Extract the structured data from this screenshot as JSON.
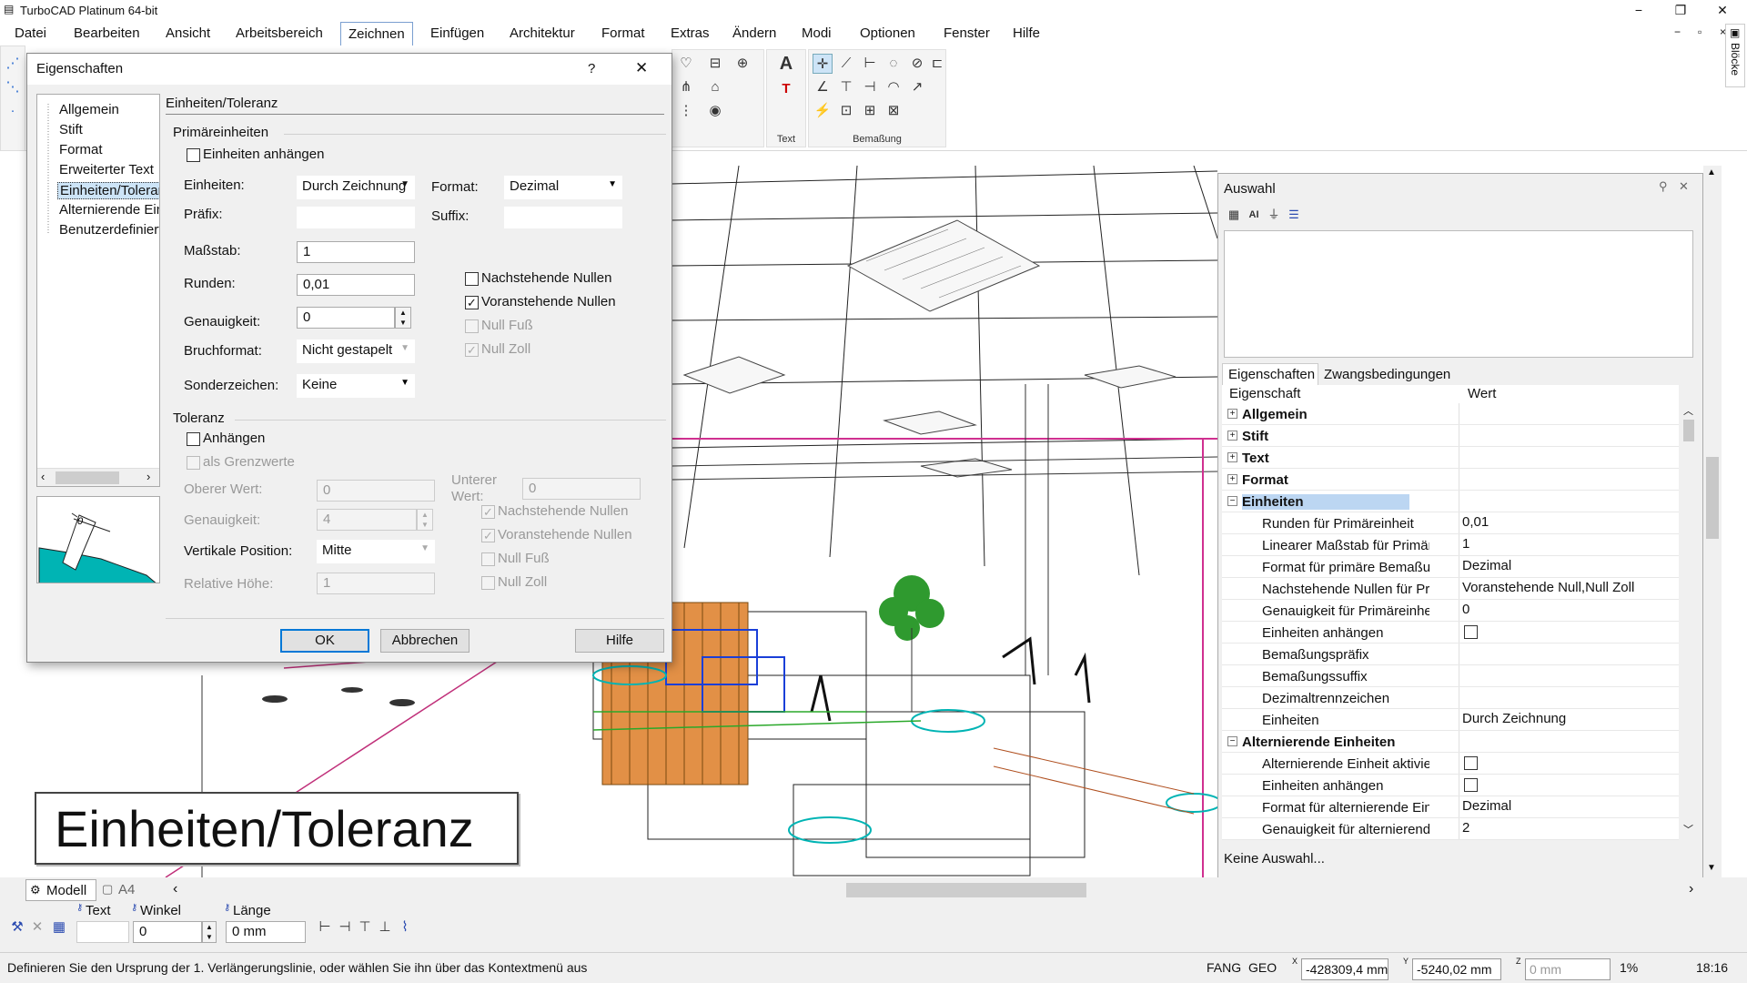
{
  "app": {
    "title": "TurboCAD  Platinum 64-bit",
    "window_controls": [
      "−",
      "❐",
      "✕"
    ],
    "mdi_controls": [
      "−",
      "▫",
      "×"
    ],
    "side_tab": "Blöcke"
  },
  "menu": {
    "items": [
      "Datei",
      "Bearbeiten",
      "Ansicht",
      "Arbeitsbereich",
      "Zeichnen",
      "Einfügen",
      "Architektur",
      "Format",
      "Extras",
      "Ändern",
      "Modi",
      "Optionen",
      "Fenster",
      "Hilfe"
    ],
    "active_index": 4
  },
  "ribbon": {
    "group_text_label": "Text",
    "group_dim_label": "Bemaßung"
  },
  "dialog": {
    "title": "Eigenschaften",
    "help_glyph": "?",
    "close_glyph": "✕",
    "tree": [
      "Allgemein",
      "Stift",
      "Format",
      "Erweiterter Text",
      "Einheiten/Toleranz",
      "Alternierende Einheiten",
      "Benutzerdefiniert"
    ],
    "tree_selected_index": 4,
    "section_title": "Einheiten/Toleranz",
    "primary": {
      "heading": "Primäreinheiten",
      "attach_units": {
        "label": "Einheiten anhängen",
        "checked": false
      },
      "units": {
        "label": "Einheiten:",
        "value": "Durch Zeichnung"
      },
      "format": {
        "label": "Format:",
        "value": "Dezimal"
      },
      "prefix": {
        "label": "Präfix:",
        "value": ""
      },
      "suffix": {
        "label": "Suffix:",
        "value": ""
      },
      "scale": {
        "label": "Maßstab:",
        "value": "1"
      },
      "round": {
        "label": "Runden:",
        "value": "0,01"
      },
      "precision": {
        "label": "Genauigkeit:",
        "value": "0"
      },
      "fraction": {
        "label": "Bruchformat:",
        "value": "Nicht gestapelt"
      },
      "special": {
        "label": "Sonderzeichen:",
        "value": "Keine"
      },
      "trailing_zeros": {
        "label": "Nachstehende Nullen",
        "checked": false
      },
      "leading_zeros": {
        "label": "Voranstehende Nullen",
        "checked": true
      },
      "zero_feet": {
        "label": "Null Fuß",
        "checked": false
      },
      "zero_inches": {
        "label": "Null Zoll",
        "checked": true
      }
    },
    "tolerance": {
      "heading": "Toleranz",
      "attach": {
        "label": "Anhängen",
        "checked": false
      },
      "as_limits": {
        "label": "als Grenzwerte",
        "checked": false
      },
      "upper": {
        "label": "Oberer Wert:",
        "value": "0"
      },
      "lower": {
        "label": "Unterer Wert:",
        "value": "0"
      },
      "precision": {
        "label": "Genauigkeit:",
        "value": "4"
      },
      "vertical_position": {
        "label": "Vertikale Position:",
        "value": "Mitte"
      },
      "relative_height": {
        "label": "Relative Höhe:",
        "value": "1"
      },
      "trailing_zeros": {
        "label": "Nachstehende Nullen",
        "checked": true
      },
      "leading_zeros": {
        "label": "Voranstehende Nullen",
        "checked": true
      },
      "zero_feet": {
        "label": "Null Fuß",
        "checked": false
      },
      "zero_inches": {
        "label": "Null Zoll",
        "checked": false
      }
    },
    "preview_text": "0",
    "buttons": {
      "ok": "OK",
      "cancel": "Abbrechen",
      "help": "Hilfe"
    }
  },
  "auswahl": {
    "title": "Auswahl",
    "toolbar_icons": [
      "properties-icon",
      "all-text-icon",
      "filter-icon",
      "layers-icon"
    ],
    "tabs": [
      "Eigenschaften",
      "Zwangsbedingungen"
    ],
    "col_property": "Eigenschaft",
    "col_value": "Wert",
    "rows": [
      {
        "k": "Allgemein",
        "v": "",
        "cat": true,
        "exp": "+"
      },
      {
        "k": "Stift",
        "v": "",
        "cat": true,
        "exp": "+"
      },
      {
        "k": "Text",
        "v": "",
        "cat": true,
        "exp": "+"
      },
      {
        "k": "Format",
        "v": "",
        "cat": true,
        "exp": "+"
      },
      {
        "k": "Einheiten",
        "v": "",
        "cat": true,
        "exp": "−",
        "sel": true
      },
      {
        "k": "Runden für Primäreinheit",
        "v": "0,01"
      },
      {
        "k": "Linearer Maßstab für Primärei...",
        "v": "1"
      },
      {
        "k": "Format für primäre Bemaßung...",
        "v": "Dezimal"
      },
      {
        "k": "Nachstehende Nullen für Prim...",
        "v": "Voranstehende Null,Null Zoll"
      },
      {
        "k": "Genauigkeit für Primäreinheit",
        "v": "0"
      },
      {
        "k": "Einheiten anhängen",
        "v": "",
        "checkbox": true
      },
      {
        "k": "Bemaßungspräfix",
        "v": ""
      },
      {
        "k": "Bemaßungssuffix",
        "v": ""
      },
      {
        "k": "Dezimaltrennzeichen",
        "v": ""
      },
      {
        "k": "Einheiten",
        "v": "Durch Zeichnung"
      },
      {
        "k": "Alternierende Einheiten",
        "v": "",
        "cat": true,
        "exp": "−"
      },
      {
        "k": "Alternierende Einheit aktiviert",
        "v": "",
        "checkbox": true
      },
      {
        "k": "Einheiten anhängen",
        "v": "",
        "checkbox": true
      },
      {
        "k": "Format für alternierende Einhe...",
        "v": "Dezimal"
      },
      {
        "k": "Genauigkeit für alternierende ...",
        "v": "2"
      }
    ],
    "footer": "Keine Auswahl..."
  },
  "caption": "Einheiten/Toleranz",
  "tabs": {
    "model": "Modell",
    "layout": "A4"
  },
  "inputbar": {
    "text_label": "Text",
    "angle_label": "Winkel",
    "angle_value": "0",
    "length_label": "Länge",
    "length_value": "0 mm"
  },
  "status": {
    "message": "Definieren Sie den Ursprung der 1. Verlängerungslinie, oder wählen Sie ihn über das Kontextmenü aus",
    "fang": "FANG",
    "geo": "GEO",
    "x": "-428309,4 mm",
    "y": "-5240,02 mm",
    "z": "0 mm",
    "zoom": "1%",
    "time": "18:16"
  },
  "colors": {
    "accent": "#0078d7",
    "selection": "#cde4f7",
    "teal": "#00b4b4"
  }
}
